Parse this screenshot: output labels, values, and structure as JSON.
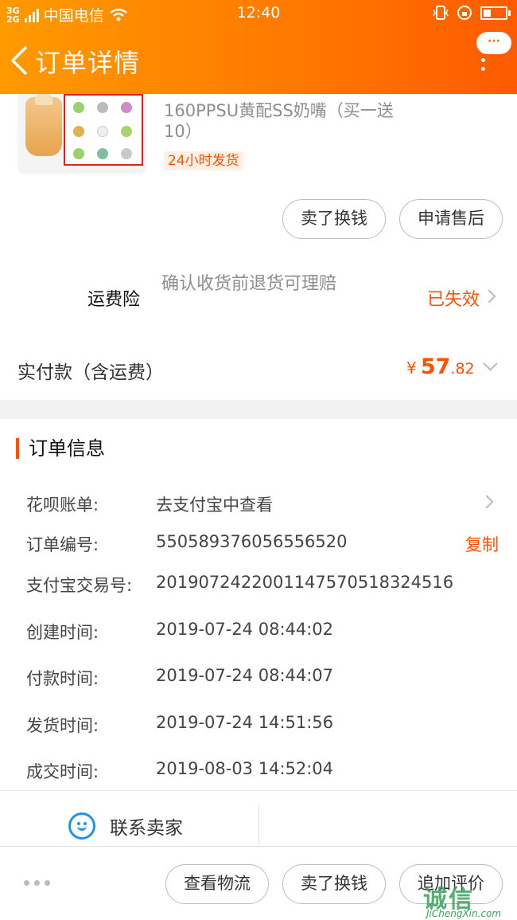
{
  "status_bar": {
    "network": "3G\n2G",
    "carrier": "中国电信",
    "time": "12:40"
  },
  "header": {
    "title": "订单详情",
    "more_label": "···"
  },
  "product": {
    "name": "160PPSU黄配SS奶嘴（买一送10）",
    "badge": "24小时发货",
    "buttons": [
      "卖了换钱",
      "申请售后"
    ]
  },
  "insurance": {
    "label": "运费险",
    "description": "确认收货前退货可理赔",
    "status": "已失效"
  },
  "payment": {
    "label": "实付款（含运费）",
    "currency": "¥",
    "amount_int": "57",
    "amount_dec": ".82"
  },
  "order_info": {
    "title": "订单信息",
    "rows": [
      {
        "label": "花呗账单:",
        "value": "去支付宝中查看"
      },
      {
        "label": "订单编号:",
        "value": "550589376056556520"
      },
      {
        "label": "支付宝交易号:",
        "value": "2019072422001147570518324516"
      },
      {
        "label": "创建时间:",
        "value": "2019-07-24 08:44:02"
      },
      {
        "label": "付款时间:",
        "value": "2019-07-24 08:44:07"
      },
      {
        "label": "发货时间:",
        "value": "2019-07-24 14:51:56"
      },
      {
        "label": "成交时间:",
        "value": "2019-08-03 14:52:04"
      }
    ],
    "copy_label": "复制",
    "contact_label": "联系卖家"
  },
  "bottom_bar": {
    "buttons": [
      "查看物流",
      "卖了换钱",
      "追加评价"
    ]
  },
  "watermark": {
    "text": "诚信",
    "domain": "JiChengXin.com"
  },
  "colors": {
    "accent": "#ff5000",
    "header_start": "#ff9a00",
    "header_end": "#ff5a00",
    "contact_icon": "#1a94f0"
  }
}
